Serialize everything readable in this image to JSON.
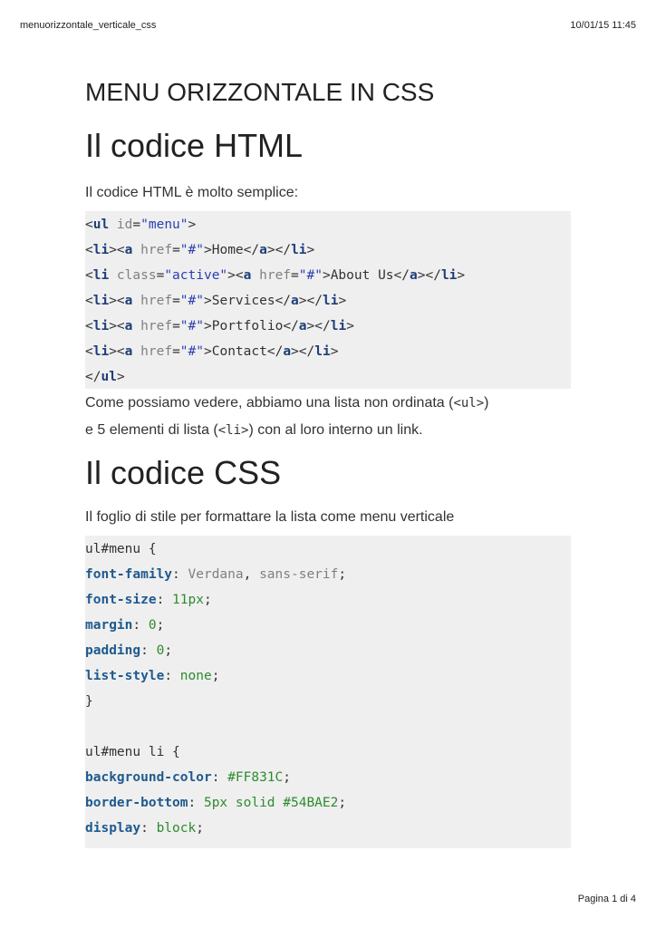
{
  "header": {
    "left": "menuorizzontale_verticale_css",
    "right": "10/01/15 11:45"
  },
  "footer": {
    "page": "Pagina 1 di 4"
  },
  "titles": {
    "menu": "MENU ORIZZONTALE IN CSS",
    "html": "Il codice HTML",
    "css": "Il codice CSS"
  },
  "paras": {
    "p1": "Il codice HTML è molto semplice:",
    "p2a": "Come possiamo vedere, abbiamo una lista non ordinata (",
    "p2code1": "<ul>",
    "p2b": ")",
    "p2c": "e 5 elementi di lista (",
    "p2code2": "<li>",
    "p2d": ") con al loro interno un link.",
    "p3": "Il foglio di stile per formattare la lista come menu verticale"
  },
  "html_code": {
    "l1": {
      "open": "<",
      "tag": "ul",
      "attr": " id",
      "eq": "=",
      "val": "\"menu\"",
      "close": ">"
    },
    "items": [
      {
        "li_open": "<",
        "li": "li",
        "li_attr": "",
        "li_eq": "",
        "li_val": "",
        "li_close": "><",
        "a": "a",
        "href": " href",
        "eq": "=",
        "hval": "\"#\"",
        "gt": ">",
        "text": "Home",
        "end1": "</",
        "a2": "a",
        "end2": "></",
        "li2": "li",
        "end3": ">"
      },
      {
        "li_open": "<",
        "li": "li",
        "li_attr": " class",
        "li_eq": "=",
        "li_val": "\"active\"",
        "li_close": "><",
        "a": "a",
        "href": " href",
        "eq": "=",
        "hval": "\"#\"",
        "gt": ">",
        "text": "About Us",
        "end1": "</",
        "a2": "a",
        "end2": "></",
        "li2": "li",
        "end3": ">"
      },
      {
        "li_open": "<",
        "li": "li",
        "li_attr": "",
        "li_eq": "",
        "li_val": "",
        "li_close": "><",
        "a": "a",
        "href": " href",
        "eq": "=",
        "hval": "\"#\"",
        "gt": ">",
        "text": "Services",
        "end1": "</",
        "a2": "a",
        "end2": "></",
        "li2": "li",
        "end3": ">"
      },
      {
        "li_open": "<",
        "li": "li",
        "li_attr": "",
        "li_eq": "",
        "li_val": "",
        "li_close": "><",
        "a": "a",
        "href": " href",
        "eq": "=",
        "hval": "\"#\"",
        "gt": ">",
        "text": "Portfolio",
        "end1": "</",
        "a2": "a",
        "end2": "></",
        "li2": "li",
        "end3": ">"
      },
      {
        "li_open": "<",
        "li": "li",
        "li_attr": "",
        "li_eq": "",
        "li_val": "",
        "li_close": "><",
        "a": "a",
        "href": " href",
        "eq": "=",
        "hval": "\"#\"",
        "gt": ">",
        "text": "Contact",
        "end1": "</",
        "a2": "a",
        "end2": "></",
        "li2": "li",
        "end3": ">"
      }
    ],
    "last": {
      "open": "</",
      "tag": "ul",
      "close": ">"
    }
  },
  "css_code": {
    "sel1": "ul#menu {",
    "rules1": [
      {
        "prop": "font-family",
        "colon": ": ",
        "val": "Verdana",
        "sep": ", ",
        "val2": "sans-serif",
        "end": ";",
        "gray": true
      },
      {
        "prop": "font-size",
        "colon": ": ",
        "val": "11px",
        "sep": "",
        "val2": "",
        "end": ";",
        "gray": false
      },
      {
        "prop": "margin",
        "colon": ": ",
        "val": "0",
        "sep": "",
        "val2": "",
        "end": ";",
        "gray": false
      },
      {
        "prop": "padding",
        "colon": ": ",
        "val": "0",
        "sep": "",
        "val2": "",
        "end": ";",
        "gray": false
      },
      {
        "prop": "list-style",
        "colon": ": ",
        "val": "none",
        "sep": "",
        "val2": "",
        "end": ";",
        "gray": false
      }
    ],
    "close1": "}",
    "sel2": "ul#menu li {",
    "rules2": [
      {
        "prop": "background-color",
        "colon": ": ",
        "val": "#FF831C",
        "end": ";"
      },
      {
        "prop": "border-bottom",
        "colon": ": ",
        "val": "5px solid #54BAE2",
        "end": ";"
      },
      {
        "prop": "display",
        "colon": ": ",
        "val": "block",
        "end": ";"
      }
    ]
  }
}
